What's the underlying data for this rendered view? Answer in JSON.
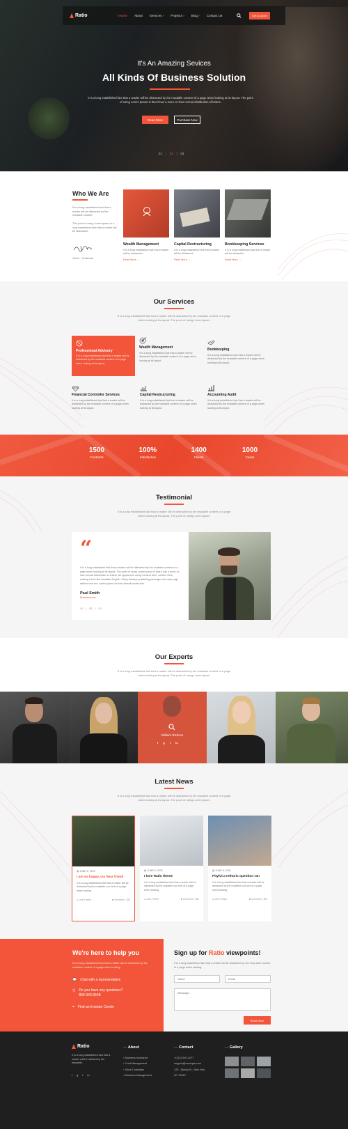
{
  "nav": {
    "logo": "Ratio",
    "items": [
      "Home",
      "About",
      "Services",
      "Projects",
      "Blog",
      "Contact Us"
    ],
    "quote_button": "Get a Quote"
  },
  "hero": {
    "kicker": "It's An Amazing Sevices",
    "title": "All Kinds Of Business Solution",
    "text": "It is a long established fact that a reader will be distracted by the readable content of a page when looking at its layout. The point of using Lorem Ipsum is that it has a more-or-less normal distribution of letters.",
    "read_more": "Read More",
    "purchase": "Purchase Now",
    "pager": [
      "01",
      "02",
      "03"
    ]
  },
  "who": {
    "title": "Who We Are",
    "p1": "It is a long established fact that a reader will be distracted by the readable content.",
    "p2": "The point of using Lorem Ipsum is a long established fact that a reader will be distracted.",
    "signature": "Jhone - Chairman",
    "cards": [
      {
        "title": "Wealth Management",
        "text": "It is a long established fact that a reader will be distracted.",
        "link": "Read More"
      },
      {
        "title": "Capital Restructuring",
        "text": "It is a long established fact that a reader will be distracted.",
        "link": "Read More"
      },
      {
        "title": "Bookkeeping Services",
        "text": "It is a long established fact that a reader will be distracted.",
        "link": "Read More"
      }
    ]
  },
  "services": {
    "title": "Our Services",
    "sub": "It is a long established fact that a reader will be distracted by the readable content of a page when looking at its layout. The point of using Lorem Ipsum",
    "items": [
      {
        "title": "Professional Advisory",
        "text": "It is a long established fact that a reader will be distracted by the readable content of a page when looking at its layout."
      },
      {
        "title": "Wealth Management",
        "text": "It is a long established fact that a reader will be distracted by the readable content of a page when looking at its layout."
      },
      {
        "title": "Bookkeeping",
        "text": "It is a long established fact that a reader will be distracted by the readable content of a page when looking at its layout."
      },
      {
        "title": "Financial Controller Services",
        "text": "It is a long established fact that a reader will be distracted by the readable content of a page when looking at its layout."
      },
      {
        "title": "Capital Restructuring",
        "text": "It is a long established fact that a reader will be distracted by the readable content of a page when looking at its layout."
      },
      {
        "title": "Accounting Audit",
        "text": "It is a long established fact that a reader will be distracted by the readable content of a page when looking at its layout."
      }
    ]
  },
  "stats": [
    {
      "value": "1500",
      "label": "Contracts"
    },
    {
      "value": "100%",
      "label": "Satisfaction"
    },
    {
      "value": "1400",
      "label": "Clients"
    },
    {
      "value": "1000",
      "label": "Cases"
    }
  ],
  "testimonial": {
    "title": "Testimonial",
    "sub": "It is a long established fact that a reader will be distracted by the readable content of a page when looking at its layout. The point of using Lorem Ipsum",
    "quote": "It is a long established fact that a reader will be distracted by the readable content of a page when looking at its layout. The point of using Lorem Ipsum is that it has a more-or-less normal distribution of letters, as opposed to using Content here, content here, making it look like readable English. Many desktop publishing packages and web page editors now use Lorem Ipsum as their default model text.",
    "name": "Paul Smith",
    "role": "Businessman",
    "pager": [
      "01",
      "02",
      "03"
    ]
  },
  "experts": {
    "title": "Our Experts",
    "sub": "It is a long established fact that a reader will be distracted by the readable content of a page when looking at its layout. The point of using Lorem Ipsum",
    "featured_name": "William Rickson"
  },
  "news": {
    "title": "Latest News",
    "sub": "It is a long established fact that a reader will be distracted by the readable content of a page when looking at its layout. The point of using Lorem Ipsum",
    "posts": [
      {
        "date": "JUNE 6, 2020",
        "title": "I am so happy, my dear friend",
        "text": "It is a long established fact that a reader will be distracted by the readable con-tent of a page when looking.",
        "author": "John Parker",
        "comments": "Comment : 350"
      },
      {
        "date": "JUNE 6, 2020",
        "title": "I love Ratio theme",
        "text": "It is a long established fact that a reader will be distracted by the readable con-tent of a page when looking.",
        "author": "John Parker",
        "comments": "Comment : 350"
      },
      {
        "date": "JUNE 6, 2020",
        "title": "Pityful a rethoric question ran",
        "text": "It is a long established fact that a reader will be distracted by the readable con-tent of a page when looking.",
        "author": "John Parker",
        "comments": "Comment : 350"
      }
    ]
  },
  "help": {
    "title": "We're here to help you",
    "text": "It is a long established fact that a reader will be distracted by the readable content of a page when looking.",
    "chat": "Chat with a representative",
    "questions": "Do you have any questions?",
    "phone": "800-343-3548",
    "investor": "Find an Investor Center"
  },
  "signup": {
    "title_a": "Sign up for",
    "brand": "Ratio",
    "title_b": "viewpoints!",
    "text": "It is a long established fact that a reader will be distracted by the read-able content of a page when looking.",
    "name_ph": "Name",
    "email_ph": "Email",
    "message_ph": "Message...",
    "submit": "Read More"
  },
  "footer": {
    "logo": "Ratio",
    "text": "It is a long established fact that a reader will be distract by the readable.",
    "about_title": "About",
    "about_links": [
      "Business Insurance",
      "Fund Management",
      "Stock Custodian",
      "Business Management"
    ],
    "contact_title": "Contact",
    "contact_lines": [
      "+(212) 000-2477",
      "support@example.com",
      "125 , Spring St , New York",
      "NY 10012"
    ],
    "gallery_title": "Gallery"
  },
  "colors": {
    "accent": "#f2553a",
    "dark": "#1f1f1f"
  }
}
